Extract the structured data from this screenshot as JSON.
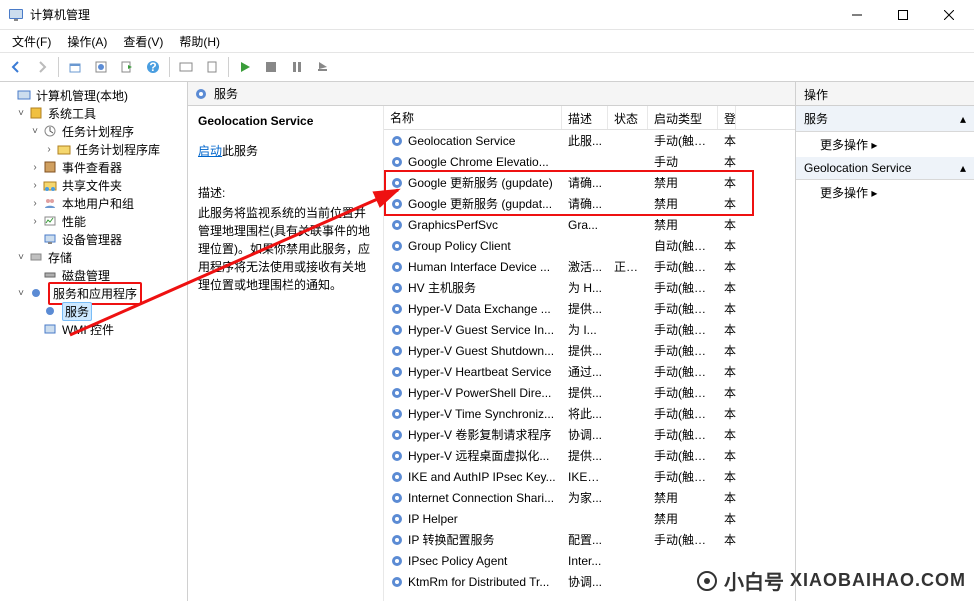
{
  "window": {
    "title": "计算机管理"
  },
  "menu": [
    "文件(F)",
    "操作(A)",
    "查看(V)",
    "帮助(H)"
  ],
  "tree": {
    "root": "计算机管理(本地)",
    "systools": "系统工具",
    "sched": "任务计划程序",
    "schedlib": "任务计划程序库",
    "eventvwr": "事件查看器",
    "shared": "共享文件夹",
    "users": "本地用户和组",
    "perf": "性能",
    "devmgr": "设备管理器",
    "storage": "存储",
    "diskmgmt": "磁盘管理",
    "svcapps": "服务和应用程序",
    "services": "服务",
    "wmi": "WMI 控件"
  },
  "mid": {
    "hdr": "服务",
    "selname": "Geolocation Service",
    "startlink": "启动",
    "starttext": "此服务",
    "desclabel": "描述:",
    "desc": "此服务将监视系统的当前位置并管理地理围栏(具有关联事件的地理位置)。如果你禁用此服务，应用程序将无法使用或接收有关地理位置或地理围栏的通知。"
  },
  "columns": [
    "名称",
    "描述",
    "状态",
    "启动类型",
    "登"
  ],
  "rows": [
    {
      "name": "Geolocation Service",
      "desc": "此服...",
      "status": "",
      "start": "手动(触发...",
      "log": "本"
    },
    {
      "name": "Google Chrome Elevatio...",
      "desc": "",
      "status": "",
      "start": "手动",
      "log": "本"
    },
    {
      "name": "Google 更新服务 (gupdate)",
      "desc": "请确...",
      "status": "",
      "start": "禁用",
      "log": "本"
    },
    {
      "name": "Google 更新服务 (gupdat...",
      "desc": "请确...",
      "status": "",
      "start": "禁用",
      "log": "本"
    },
    {
      "name": "GraphicsPerfSvc",
      "desc": "Gra...",
      "status": "",
      "start": "禁用",
      "log": "本"
    },
    {
      "name": "Group Policy Client",
      "desc": "",
      "status": "",
      "start": "自动(触发...",
      "log": "本"
    },
    {
      "name": "Human Interface Device ...",
      "desc": "激活...",
      "status": "正在...",
      "start": "手动(触发...",
      "log": "本"
    },
    {
      "name": "HV 主机服务",
      "desc": "为 H...",
      "status": "",
      "start": "手动(触发...",
      "log": "本"
    },
    {
      "name": "Hyper-V Data Exchange ...",
      "desc": "提供...",
      "status": "",
      "start": "手动(触发...",
      "log": "本"
    },
    {
      "name": "Hyper-V Guest Service In...",
      "desc": "为 I...",
      "status": "",
      "start": "手动(触发...",
      "log": "本"
    },
    {
      "name": "Hyper-V Guest Shutdown...",
      "desc": "提供...",
      "status": "",
      "start": "手动(触发...",
      "log": "本"
    },
    {
      "name": "Hyper-V Heartbeat Service",
      "desc": "通过...",
      "status": "",
      "start": "手动(触发...",
      "log": "本"
    },
    {
      "name": "Hyper-V PowerShell Dire...",
      "desc": "提供...",
      "status": "",
      "start": "手动(触发...",
      "log": "本"
    },
    {
      "name": "Hyper-V Time Synchroniz...",
      "desc": "将此...",
      "status": "",
      "start": "手动(触发...",
      "log": "本"
    },
    {
      "name": "Hyper-V 卷影复制请求程序",
      "desc": "协调...",
      "status": "",
      "start": "手动(触发...",
      "log": "本"
    },
    {
      "name": "Hyper-V 远程桌面虚拟化...",
      "desc": "提供...",
      "status": "",
      "start": "手动(触发...",
      "log": "本"
    },
    {
      "name": "IKE and AuthIP IPsec Key...",
      "desc": "IKEE...",
      "status": "",
      "start": "手动(触发...",
      "log": "本"
    },
    {
      "name": "Internet Connection Shari...",
      "desc": "为家...",
      "status": "",
      "start": "禁用",
      "log": "本"
    },
    {
      "name": "IP Helper",
      "desc": "",
      "status": "",
      "start": "禁用",
      "log": "本"
    },
    {
      "name": "IP 转换配置服务",
      "desc": "配置...",
      "status": "",
      "start": "手动(触发...",
      "log": "本"
    },
    {
      "name": "IPsec Policy Agent",
      "desc": "Inter...",
      "status": "",
      "start": "",
      "log": ""
    },
    {
      "name": "KtmRm for Distributed Tr...",
      "desc": "协调...",
      "status": "",
      "start": "",
      "log": ""
    }
  ],
  "actions": {
    "hdr": "操作",
    "sec1": "服务",
    "more": "更多操作",
    "sec2": "Geolocation Service"
  },
  "watermark": {
    "a": "小白号",
    "b": "XIAOBAIHAO.COM"
  }
}
